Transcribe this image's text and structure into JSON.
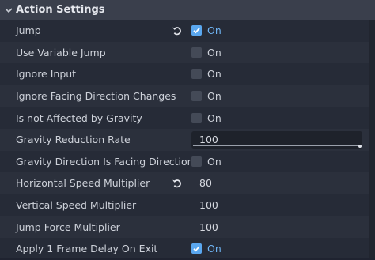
{
  "section": {
    "title": "Action Settings",
    "expanded": true
  },
  "colors": {
    "accent": "#5aa7ef",
    "panel": "#262b37",
    "header": "#3a3f4c"
  },
  "icons": {
    "collapse": "chevron-down-icon",
    "revert": "revert-icon",
    "check": "checkmark-icon"
  },
  "properties": [
    {
      "label": "Jump",
      "type": "bool",
      "checked": true,
      "value": "On",
      "revert": true
    },
    {
      "label": "Use Variable Jump",
      "type": "bool",
      "checked": false,
      "value": "On",
      "revert": false
    },
    {
      "label": "Ignore Input",
      "type": "bool",
      "checked": false,
      "value": "On",
      "revert": false
    },
    {
      "label": "Ignore Facing Direction Changes",
      "type": "bool",
      "checked": false,
      "value": "On",
      "revert": false
    },
    {
      "label": "Is not Affected by Gravity",
      "type": "bool",
      "checked": false,
      "value": "On",
      "revert": false
    },
    {
      "label": "Gravity Reduction Rate",
      "type": "slider",
      "value": "100",
      "fill": 1.0,
      "revert": false
    },
    {
      "label": "Gravity Direction Is Facing Direction",
      "type": "bool",
      "checked": false,
      "value": "On",
      "revert": false
    },
    {
      "label": "Horizontal Speed Multiplier",
      "type": "number",
      "value": "80",
      "revert": true
    },
    {
      "label": "Vertical Speed Multiplier",
      "type": "number",
      "value": "100",
      "revert": false
    },
    {
      "label": "Jump Force Multiplier",
      "type": "number",
      "value": "100",
      "revert": false
    },
    {
      "label": "Apply 1 Frame Delay On Exit",
      "type": "bool",
      "checked": true,
      "value": "On",
      "revert": false
    }
  ]
}
